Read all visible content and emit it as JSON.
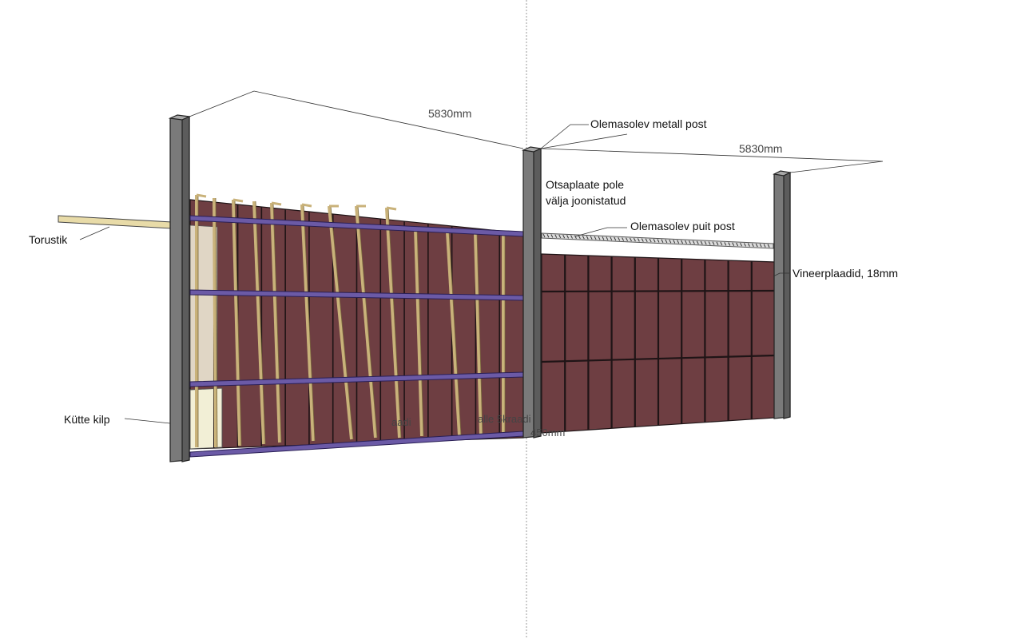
{
  "colors": {
    "panel": "#6e3e42",
    "panel_stroke": "#1f1416",
    "rail": "#6b5aa6",
    "timber": "#e8dba8",
    "post": "#7a7a7a",
    "guide": "#9a9a9a"
  },
  "labels": {
    "torustik": "Torustik",
    "kutte_kilp": "Kütte kilp",
    "metal_post": "Olemasolev metall post",
    "end_plates_l1": "Otsaplaate pole",
    "end_plates_l2": "välja joonistatud",
    "wood_post": "Olemasolev puit post",
    "plywood": "Vineerplaadid, 18mm"
  },
  "dimensions": {
    "left_span": "5830mm",
    "right_span": "5830mm"
  },
  "fragments": {
    "a": "aadi",
    "b": "alle 5kraadi",
    "c": "450mm"
  }
}
